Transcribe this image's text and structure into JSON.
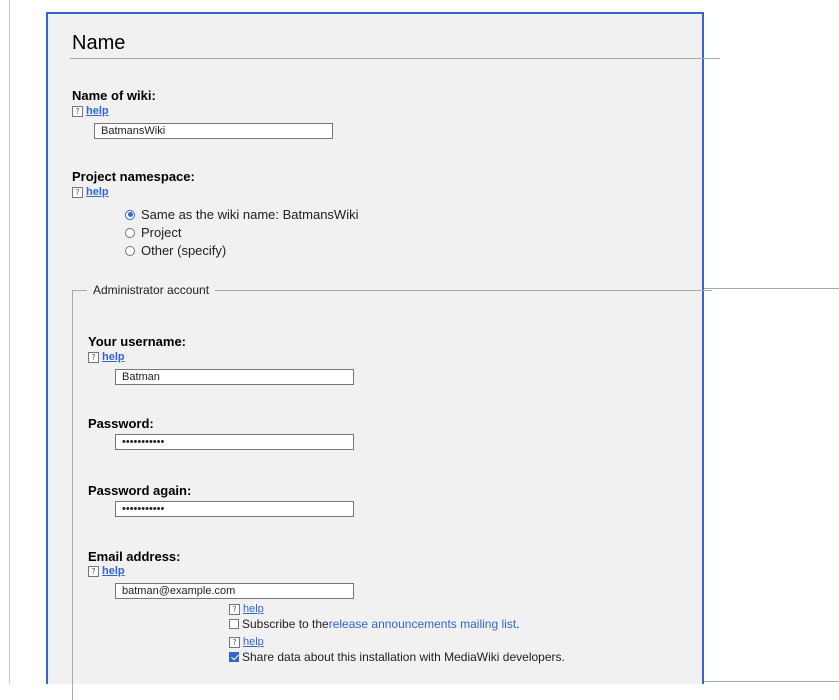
{
  "section": {
    "title": "Name"
  },
  "wiki_name": {
    "label": "Name of wiki:",
    "help": "help",
    "value": "BatmansWiki"
  },
  "namespace": {
    "label": "Project namespace:",
    "help": "help",
    "options": [
      {
        "label": "Same as the wiki name: BatmansWiki",
        "checked": true
      },
      {
        "label": "Project",
        "checked": false
      },
      {
        "label": "Other (specify)",
        "checked": false
      }
    ]
  },
  "admin": {
    "legend": "Administrator account",
    "username": {
      "label": "Your username:",
      "help": "help",
      "value": "Batman"
    },
    "password": {
      "label": "Password:",
      "value": "•••••••••••"
    },
    "password_again": {
      "label": "Password again:",
      "value": "•••••••••••"
    },
    "email": {
      "label": "Email address:",
      "help": "help",
      "value": "batman@example.com"
    },
    "subscribe": {
      "help": "help",
      "text_before": "Subscribe to the ",
      "link_text": "release announcements mailing list",
      "text_after": ".",
      "checked": false
    },
    "share": {
      "help": "help",
      "text": "Share data about this installation with MediaWiki developers.",
      "checked": true
    }
  },
  "colors": {
    "accent": "#3366cc",
    "panel_bg": "#f1f1f1",
    "border": "#a2a9b1"
  }
}
